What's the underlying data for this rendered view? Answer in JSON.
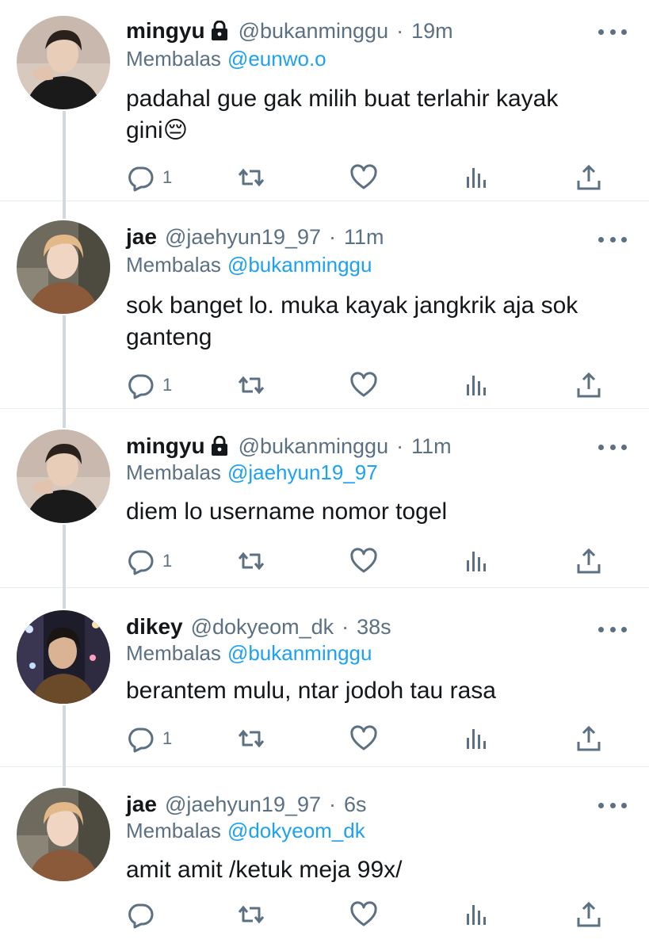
{
  "tweets": [
    {
      "name": "mingyu",
      "locked": true,
      "handle": "@bukanminggu",
      "time": "19m",
      "reply_label": "Membalas",
      "reply_to": "@eunwo.o",
      "text": "padahal gue gak milih buat terlahir kayak gini😔",
      "reply_count": "1",
      "avatar": "person-dark-shirt"
    },
    {
      "name": "jae",
      "locked": false,
      "handle": "@jaehyun19_97",
      "time": "11m",
      "reply_label": "Membalas",
      "reply_to": "@bukanminggu",
      "text": "sok banget lo. muka kayak jangkrik aja sok ganteng",
      "reply_count": "1",
      "avatar": "person-blonde-hair"
    },
    {
      "name": "mingyu",
      "locked": true,
      "handle": "@bukanminggu",
      "time": "11m",
      "reply_label": "Membalas",
      "reply_to": "@jaehyun19_97",
      "text": "diem lo username nomor togel",
      "reply_count": "1",
      "avatar": "person-dark-shirt"
    },
    {
      "name": "dikey",
      "locked": false,
      "handle": "@dokyeom_dk",
      "time": "38s",
      "reply_label": "Membalas",
      "reply_to": "@bukanminggu",
      "text": "berantem mulu, ntar jodoh tau rasa",
      "reply_count": "1",
      "avatar": "person-night-city"
    },
    {
      "name": "jae",
      "locked": false,
      "handle": "@jaehyun19_97",
      "time": "6s",
      "reply_label": "Membalas",
      "reply_to": "@dokyeom_dk",
      "text": "amit amit /ketuk meja 99x/",
      "reply_count": "",
      "avatar": "person-blonde-hair"
    }
  ],
  "colors": {
    "text": "#14171a",
    "secondary": "#5b7083",
    "mention": "#1da1f2",
    "thread_line": "#cfd9de",
    "divider": "#e6ecf0"
  },
  "icons": [
    "lock-icon",
    "more-icon",
    "reply-icon",
    "retweet-icon",
    "like-icon",
    "analytics-icon",
    "share-icon"
  ]
}
